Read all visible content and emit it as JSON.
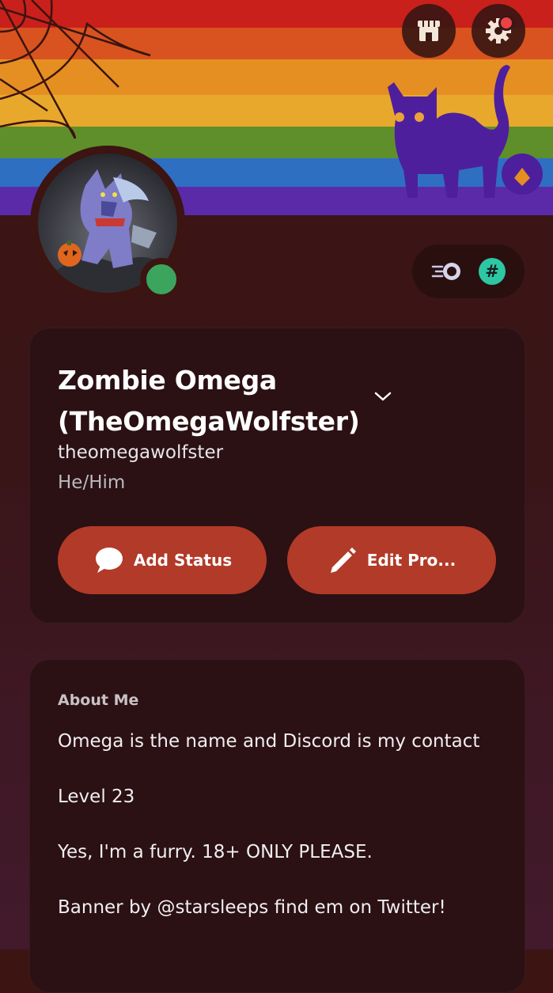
{
  "top_actions": {
    "shop_icon": "shop-icon",
    "settings_icon": "gear-icon"
  },
  "profile": {
    "display_name": "Zombie Omega (TheOmegaWolfster)",
    "username": "theomegawolfster",
    "pronouns": "He/Him",
    "online_status": "online"
  },
  "actions": {
    "add_status_label": "Add Status",
    "edit_profile_label": "Edit Pro..."
  },
  "about": {
    "title": "About Me",
    "lines": [
      "Omega is the name and Discord is my contact",
      "Level 23",
      "Yes, I'm a furry. 18+ ONLY PLEASE.",
      "Banner by @starsleeps find em on Twitter!"
    ]
  },
  "colors": {
    "accent": "#b23a28",
    "online": "#3ba55d",
    "badge_teal": "#2dc7a3",
    "background": "#3c1412"
  }
}
